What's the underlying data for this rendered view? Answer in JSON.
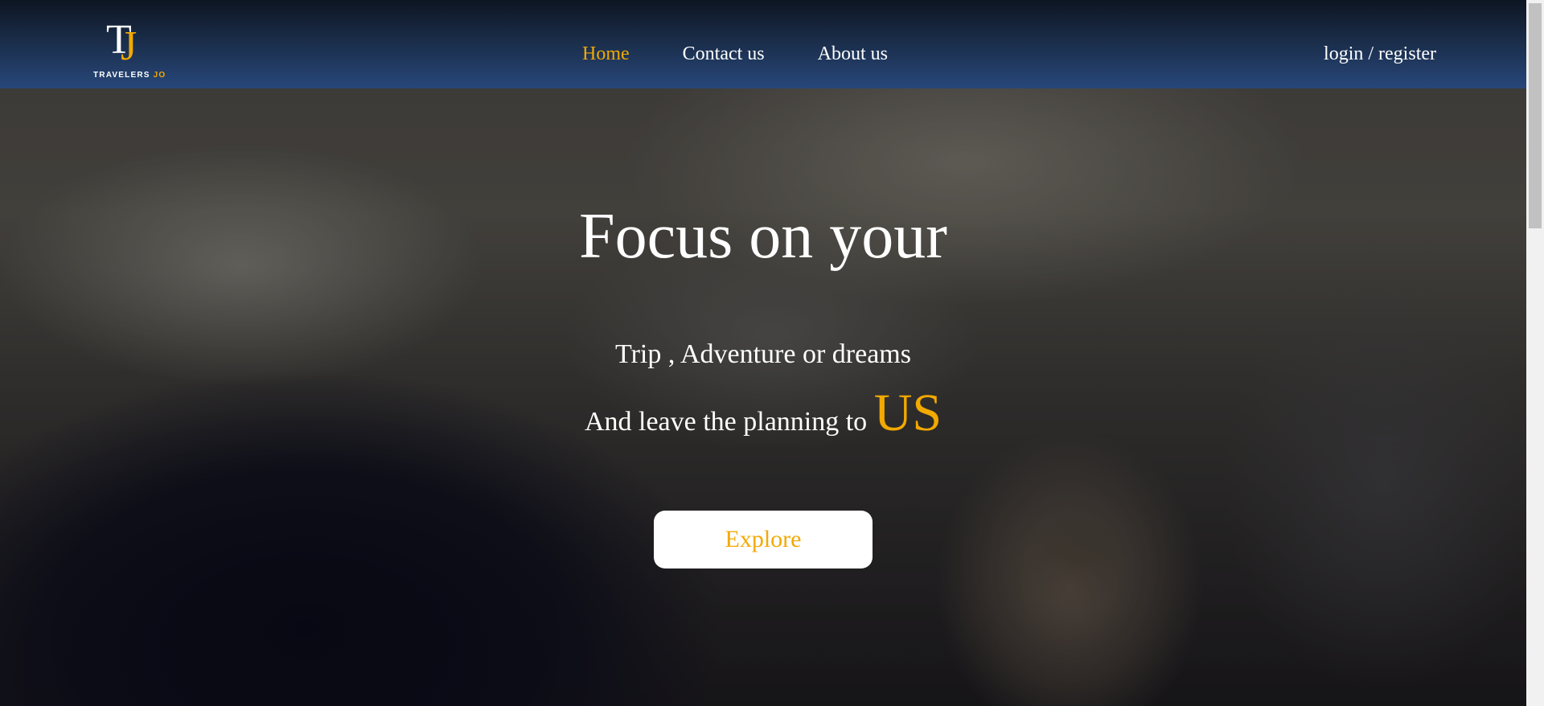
{
  "logo": {
    "mark_t": "T",
    "mark_j": "J",
    "brand_main": "TRAVELERS",
    "brand_accent": "JO"
  },
  "nav": {
    "items": [
      {
        "label": "Home",
        "active": true
      },
      {
        "label": "Contact us",
        "active": false
      },
      {
        "label": "About us",
        "active": false
      }
    ],
    "login_label": "login / register"
  },
  "hero": {
    "headline": "Focus on your",
    "subline1": "Trip , Adventure or dreams",
    "subline2_prefix": "And leave the planning to",
    "subline2_highlight": "US",
    "cta_label": "Explore"
  },
  "colors": {
    "accent": "#f2a900",
    "navbar_top": "#0d1522",
    "navbar_bottom": "#27477a",
    "text": "#ffffff"
  }
}
